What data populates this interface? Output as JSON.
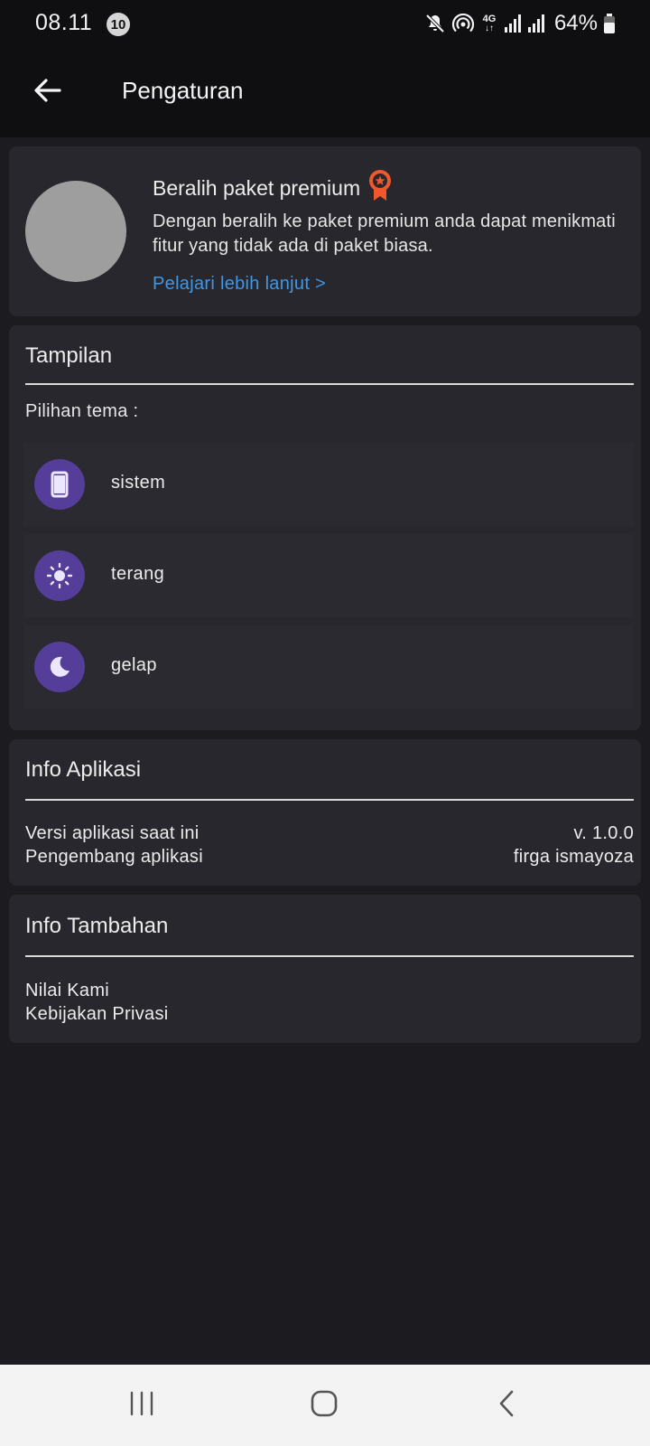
{
  "status_bar": {
    "time": "08.11",
    "notification_count": "10",
    "network_type": "4G",
    "battery": "64%"
  },
  "app_bar": {
    "title": "Pengaturan",
    "back_icon": "arrow-left-icon"
  },
  "premium": {
    "title": "Beralih paket premium",
    "description": "Dengan beralih ke paket premium anda dapat menikmati fitur yang tidak ada di paket biasa.",
    "link": "Pelajari lebih lanjut >",
    "badge_color": "#f0582b"
  },
  "tampilan": {
    "title": "Tampilan",
    "theme_label": "Pilihan tema :",
    "options": [
      {
        "label": "sistem",
        "icon": "phone-icon"
      },
      {
        "label": "terang",
        "icon": "sun-icon"
      },
      {
        "label": "gelap",
        "icon": "moon-icon"
      }
    ],
    "icon_bg_color": "#553d9a"
  },
  "info_aplikasi": {
    "title": "Info Aplikasi",
    "rows": [
      {
        "label": "Versi aplikasi saat ini",
        "value": "v. 1.0.0"
      },
      {
        "label": "Pengembang aplikasi",
        "value": "firga ismayoza"
      }
    ]
  },
  "info_tambahan": {
    "title": "Info Tambahan",
    "items": [
      "Nilai Kami",
      "Kebijakan Privasi"
    ]
  },
  "colors": {
    "background": "#1c1b20",
    "card": "#28272d",
    "link": "#3f97e6"
  }
}
